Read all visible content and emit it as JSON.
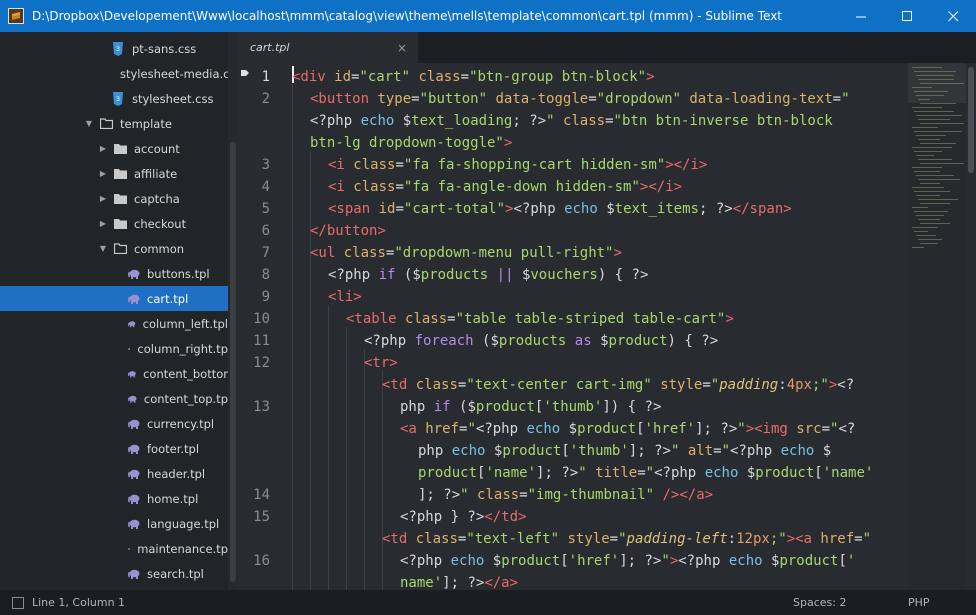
{
  "window": {
    "title": "D:\\Dropbox\\Developement\\Www\\localhost\\mmm\\catalog\\view\\theme\\mells\\template\\common\\cart.tpl (mmm) - Sublime Text",
    "minimize_icon": "minimize-icon",
    "maximize_icon": "maximize-icon",
    "close_icon": "close-icon"
  },
  "sidebar": {
    "items": [
      {
        "label": "pt-sans.css",
        "kind": "css"
      },
      {
        "label": "stylesheet-media.c",
        "kind": "css"
      },
      {
        "label": "stylesheet.css",
        "kind": "css"
      },
      {
        "label": "template",
        "kind": "folder-open"
      },
      {
        "label": "account",
        "kind": "folder"
      },
      {
        "label": "affiliate",
        "kind": "folder"
      },
      {
        "label": "captcha",
        "kind": "folder"
      },
      {
        "label": "checkout",
        "kind": "folder"
      },
      {
        "label": "common",
        "kind": "folder-open"
      },
      {
        "label": "buttons.tpl",
        "kind": "tpl"
      },
      {
        "label": "cart.tpl",
        "kind": "tpl",
        "selected": true
      },
      {
        "label": "column_left.tpl",
        "kind": "tpl"
      },
      {
        "label": "column_right.tp",
        "kind": "tpl"
      },
      {
        "label": "content_bottor",
        "kind": "tpl"
      },
      {
        "label": "content_top.tp",
        "kind": "tpl"
      },
      {
        "label": "currency.tpl",
        "kind": "tpl"
      },
      {
        "label": "footer.tpl",
        "kind": "tpl"
      },
      {
        "label": "header.tpl",
        "kind": "tpl"
      },
      {
        "label": "home.tpl",
        "kind": "tpl"
      },
      {
        "label": "language.tpl",
        "kind": "tpl"
      },
      {
        "label": "maintenance.tp",
        "kind": "tpl"
      },
      {
        "label": "search.tpl",
        "kind": "tpl"
      }
    ]
  },
  "tabs": [
    {
      "label": "cart.tpl",
      "close": "×"
    }
  ],
  "editor": {
    "line_numbers": [
      "1",
      "2",
      "3",
      "4",
      "5",
      "6",
      "7",
      "8",
      "9",
      "10",
      "11",
      "12",
      "13",
      "14",
      "15",
      "16"
    ],
    "colors": {
      "tag": "#e96b6b",
      "attribute": "#dcb16b",
      "string": "#a7d86e",
      "keyword": "#b58ae8",
      "variable": "#68b6e6"
    }
  },
  "status": {
    "position": "Line 1, Column 1",
    "spaces": "Spaces: 2",
    "syntax": "PHP"
  }
}
